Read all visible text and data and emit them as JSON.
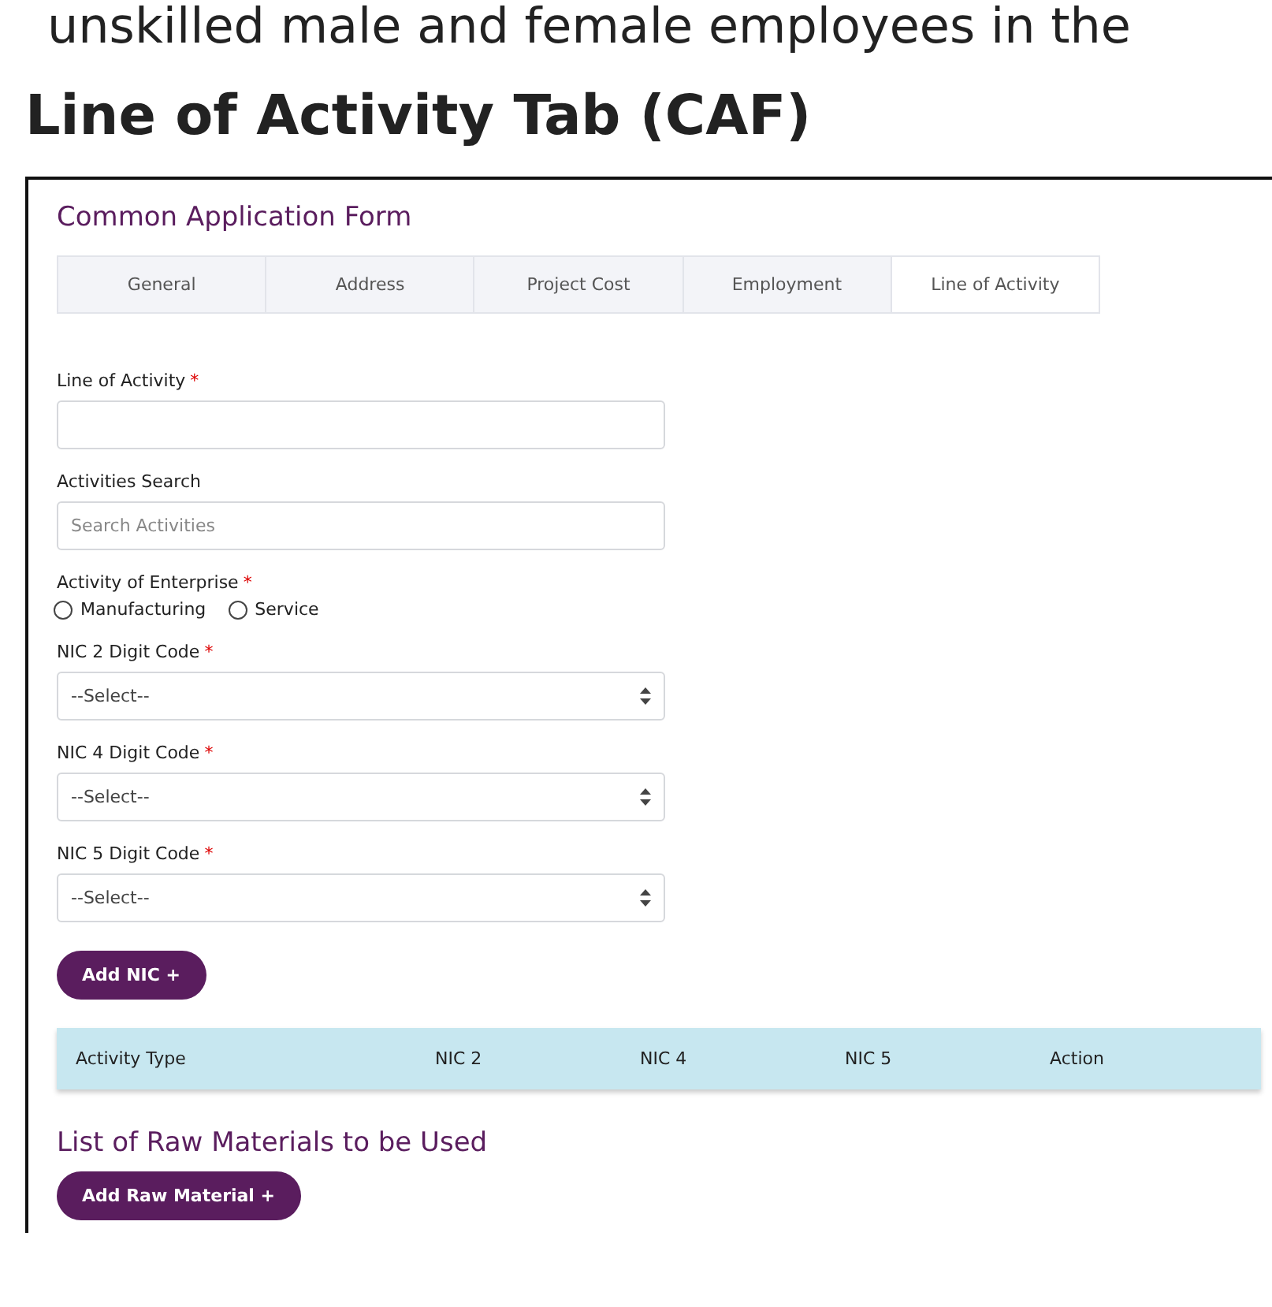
{
  "intro_text": "unskilled male and female employees in the",
  "heading": "Line of Activity Tab (CAF)",
  "form": {
    "title": "Common Application Form",
    "tabs": [
      {
        "label": "General",
        "selected": false
      },
      {
        "label": "Address",
        "selected": false
      },
      {
        "label": "Project Cost",
        "selected": false
      },
      {
        "label": "Employment",
        "selected": false
      },
      {
        "label": "Line of Activity",
        "selected": true
      }
    ],
    "fields": [
      {
        "kind": "text",
        "label": "Line of Activity",
        "required_mark": "*"
      },
      {
        "kind": "text",
        "label": "Activities Search",
        "placeholder": "Search Activities"
      },
      {
        "kind": "radio",
        "label": "Activity of Enterprise",
        "required_mark": "*",
        "options": [
          {
            "label": "Manufacturing",
            "checked": false
          },
          {
            "label": "Service",
            "checked": false
          }
        ]
      },
      {
        "kind": "select",
        "label": "NIC 2 Digit Code",
        "required_mark": "*",
        "value": "--Select--"
      },
      {
        "kind": "select",
        "label": "NIC 4 Digit Code",
        "required_mark": "*",
        "value": "--Select--"
      },
      {
        "kind": "select",
        "label": "NIC 5 Digit Code",
        "required_mark": "*",
        "value": "--Select--"
      }
    ],
    "add_button": "Add NIC +",
    "table": {
      "columns": [
        "Activity Type",
        "NIC 2",
        "NIC 4",
        "NIC 5",
        "Action"
      ]
    },
    "raw_materials": {
      "title": "List of Raw Materials to be Used",
      "add_button": "Add Raw Material +"
    }
  }
}
